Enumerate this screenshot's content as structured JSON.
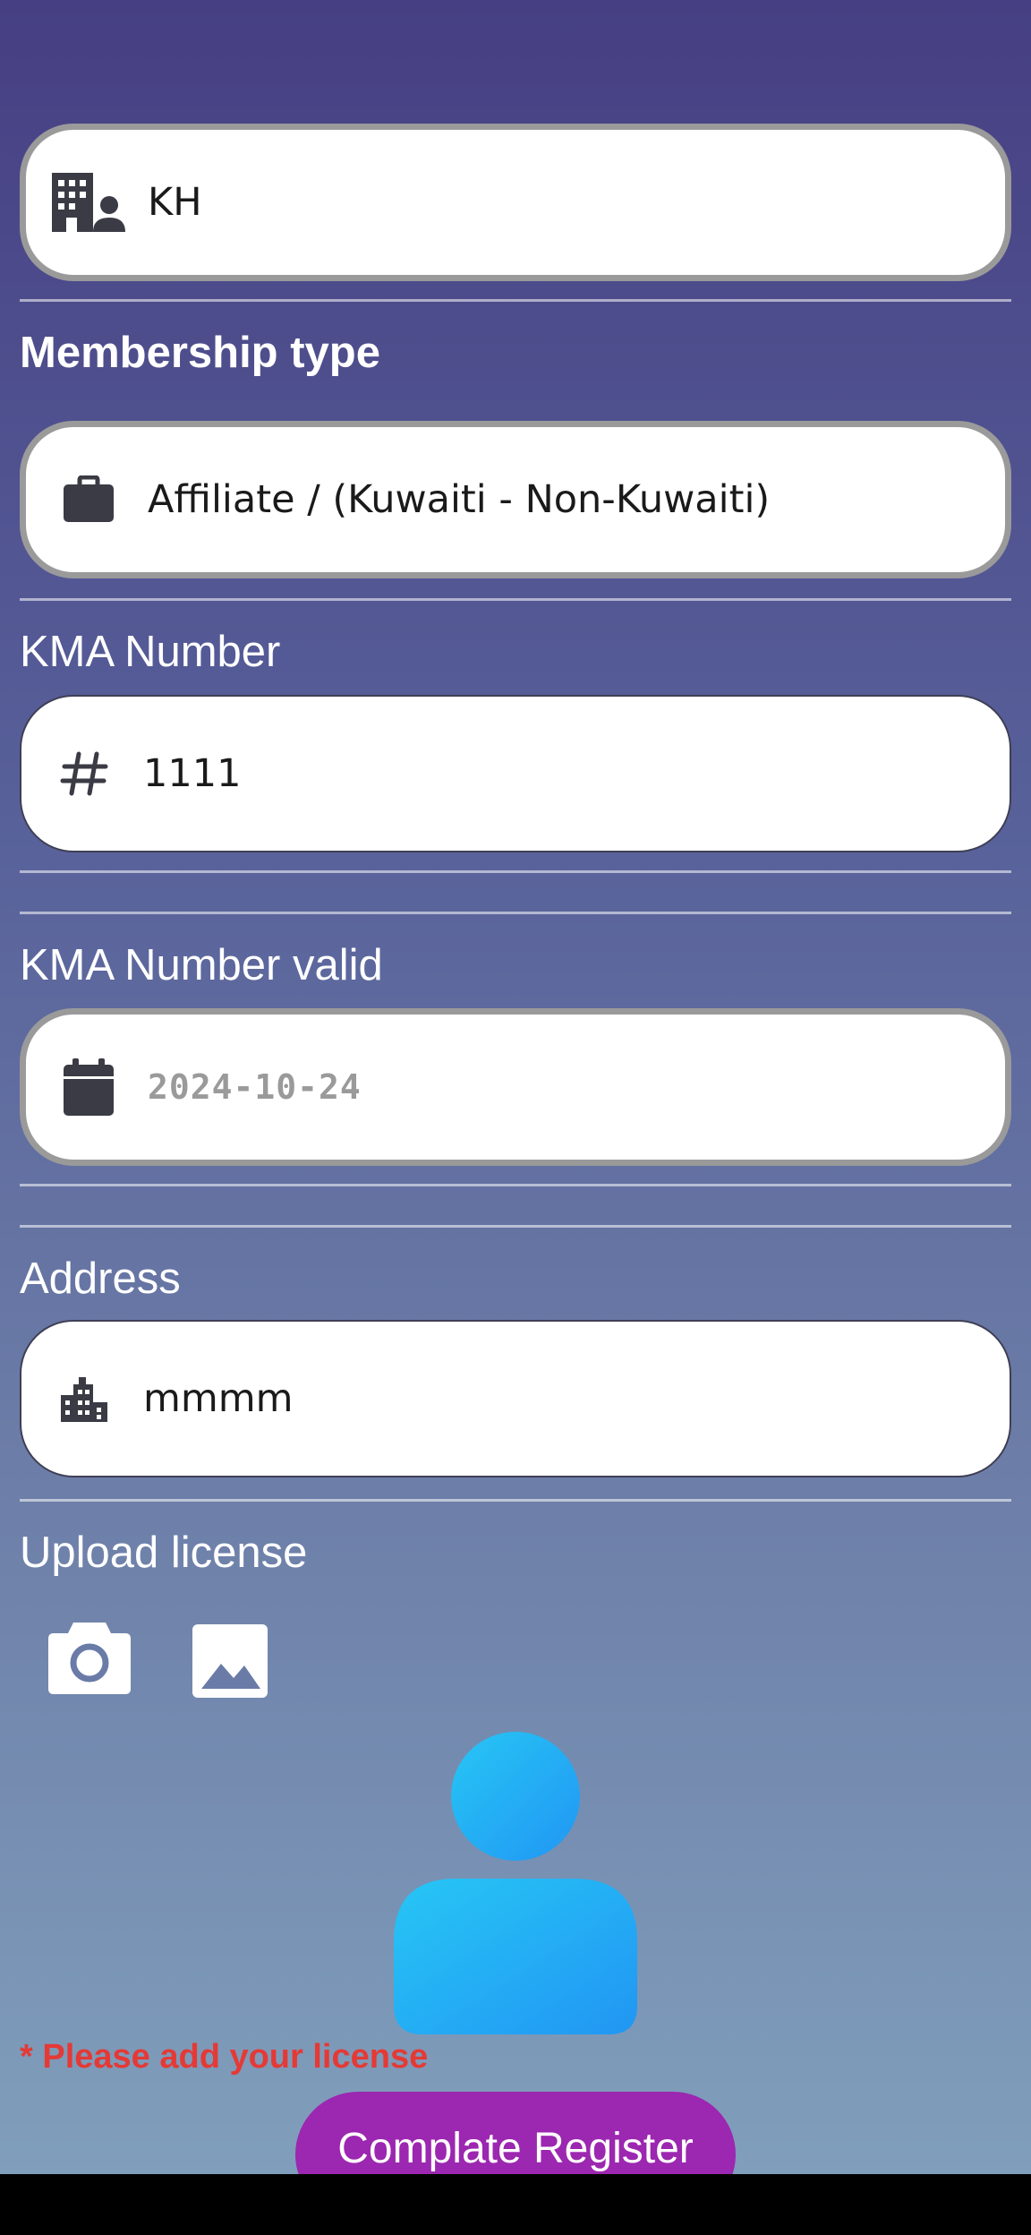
{
  "fields": {
    "organization": {
      "value": "KH",
      "icon": "building-person-icon"
    },
    "membership_type": {
      "label": "Membership type",
      "value": "Affiliate / (Kuwaiti - Non-Kuwaiti)",
      "icon": "briefcase-icon"
    },
    "kma_number": {
      "label": "KMA Number",
      "value": "1111",
      "icon": "hash-icon"
    },
    "kma_number_valid": {
      "label": "KMA Number valid",
      "placeholder": "2024-10-24",
      "icon": "calendar-icon"
    },
    "address": {
      "label": "Address",
      "value": "mmmm",
      "icon": "city-icon"
    }
  },
  "upload": {
    "label": "Upload license",
    "camera_icon": "camera-icon",
    "gallery_icon": "image-icon",
    "avatar_icon": "person-avatar-icon"
  },
  "warning": "* Please add your license",
  "submit_label": "Complate Register",
  "colors": {
    "gradient_top": "#463f83",
    "gradient_bottom": "#809fbc",
    "warning": "#e53935",
    "submit": "#9c27b0",
    "avatar_top": "#27c6f5",
    "avatar_bottom": "#2196f3"
  }
}
